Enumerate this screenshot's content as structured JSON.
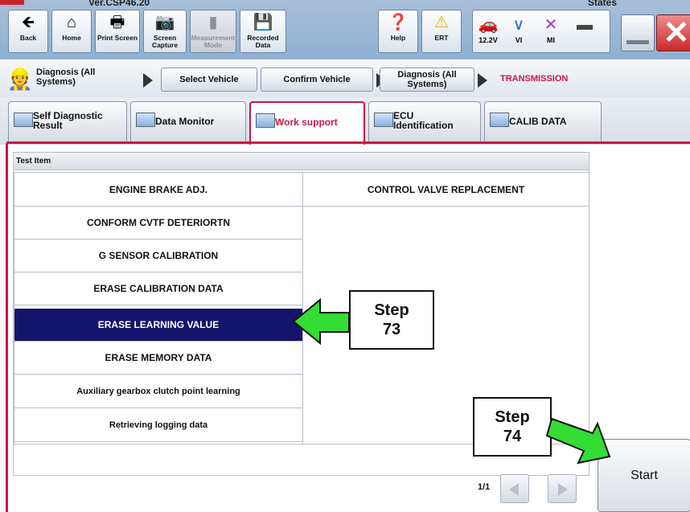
{
  "app": {
    "version": "Ver.CSP46.20",
    "states_label": "States"
  },
  "toolbar": {
    "buttons": [
      {
        "label": "Back",
        "icon": "back-arrow-icon"
      },
      {
        "label": "Home",
        "icon": "home-icon"
      },
      {
        "label": "Print Screen",
        "icon": "printer-icon"
      },
      {
        "label": "Screen Capture",
        "icon": "camera-icon"
      },
      {
        "label": "Measurement Mode",
        "icon": "measurement-icon"
      },
      {
        "label": "Recorded Data",
        "icon": "recorded-data-icon"
      },
      {
        "label": "Help",
        "icon": "help-icon"
      },
      {
        "label": "ERT",
        "icon": "warning-icon"
      }
    ],
    "status": {
      "voltage": "12.2V",
      "vi": "VI",
      "mi": "MI"
    }
  },
  "breadcrumb": {
    "root": "Diagnosis (All Systems)",
    "steps": [
      "Select Vehicle",
      "Confirm Vehicle",
      "Diagnosis (All Systems)"
    ],
    "current": "TRANSMISSION"
  },
  "tabs": [
    {
      "label": "Self Diagnostic Result"
    },
    {
      "label": "Data Monitor"
    },
    {
      "label": "Work support",
      "active": true
    },
    {
      "label": "ECU Identification"
    },
    {
      "label": "CALIB DATA"
    }
  ],
  "test_panel": {
    "header": "Test Item",
    "left_items": [
      "ENGINE BRAKE ADJ.",
      "CONFORM CVTF DETERIORTN",
      "G SENSOR CALIBRATION",
      "ERASE CALIBRATION DATA",
      "ERASE LEARNING VALUE",
      "ERASE MEMORY DATA",
      "Auxiliary gearbox clutch point learning",
      "Retrieving logging data"
    ],
    "right_items": [
      "CONTROL VALVE REPLACEMENT"
    ],
    "selected_item": "ERASE LEARNING VALUE"
  },
  "pager": {
    "label": "1/1"
  },
  "start_button": {
    "label": "Start"
  },
  "callouts": {
    "step73": {
      "line1": "Step",
      "line2": "73"
    },
    "step74": {
      "line1": "Step",
      "line2": "74"
    }
  },
  "colors": {
    "accent": "#c8174a",
    "selected_row": "#14146b",
    "arrow_green": "#33dd33"
  }
}
